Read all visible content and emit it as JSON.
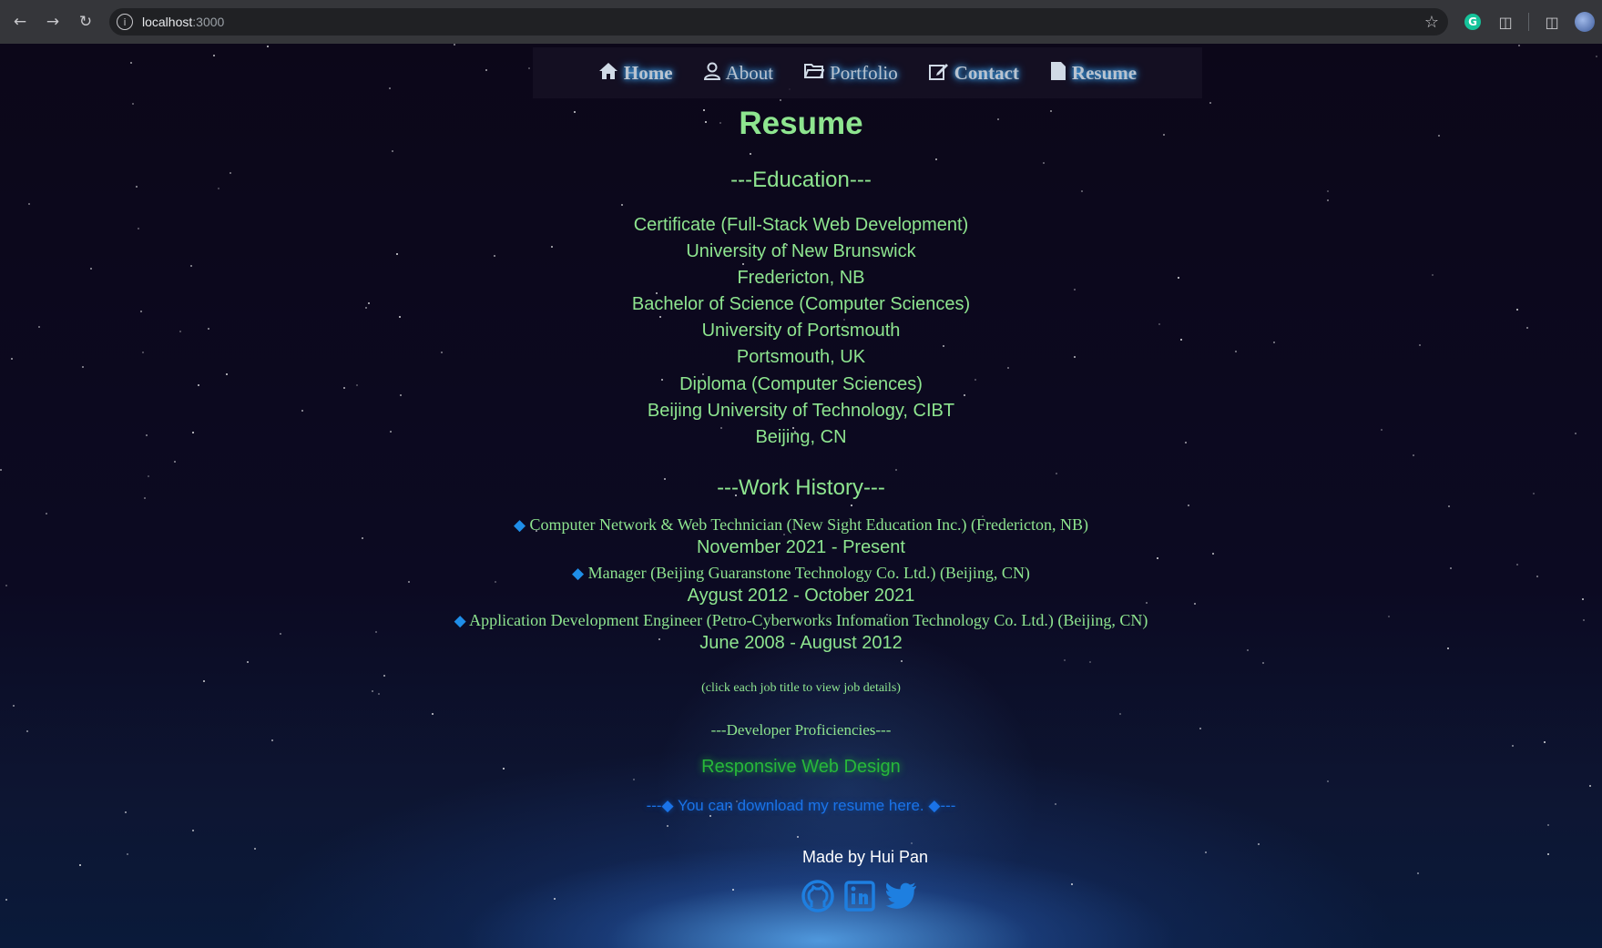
{
  "browser": {
    "url_host": "localhost",
    "url_port": ":3000"
  },
  "nav": {
    "items": [
      {
        "label": "Home",
        "icon": "home-icon"
      },
      {
        "label": "About",
        "icon": "user-icon"
      },
      {
        "label": "Portfolio",
        "icon": "folder-icon"
      },
      {
        "label": "Contact",
        "icon": "edit-icon"
      },
      {
        "label": "Resume",
        "icon": "file-icon"
      }
    ]
  },
  "page": {
    "title": "Resume",
    "education_heading": "---Education---",
    "education": [
      "Certificate (Full-Stack Web Development)",
      "University of New Brunswick",
      "Fredericton, NB",
      "Bachelor of Science (Computer Sciences)",
      "University of Portsmouth",
      "Portsmouth, UK",
      "Diploma (Computer Sciences)",
      "Beijing University of Technology, CIBT",
      "Beijing, CN"
    ],
    "work_heading": "---Work History---",
    "jobs": [
      {
        "title": "Computer Network & Web Technician (New Sight Education Inc.) (Fredericton, NB)",
        "dates": "November 2021 - Present"
      },
      {
        "title": "Manager (Beijing Guaranstone Technology Co. Ltd.) (Beijing, CN)",
        "dates": "Aygust 2012 - October 2021"
      },
      {
        "title": "Application Development Engineer (Petro-Cyberworks Infomation Technology Co. Ltd.) (Beijing, CN)",
        "dates": "June 2008 - August 2012"
      }
    ],
    "job_note": "(click each job title to view job details)",
    "dev_heading": "---Developer Proficiencies---",
    "skill": "Responsive Web Design",
    "download_prefix": "---",
    "download_text": "You can download my resume here.",
    "download_suffix": "---",
    "made_by": "Made by Hui Pan"
  },
  "colors": {
    "accent_green": "#8ee58f",
    "skill_green": "#27b83a",
    "link_blue": "#1a73e8",
    "diamond_blue": "#1f8ee8"
  },
  "footer": {
    "socials": [
      "github-icon",
      "linkedin-icon",
      "twitter-icon"
    ]
  }
}
